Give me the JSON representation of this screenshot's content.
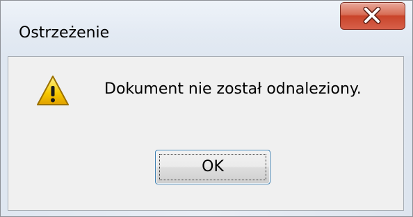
{
  "dialog": {
    "title": "Ostrzeżenie",
    "message": "Dokument nie został odnaleziony.",
    "ok_label": "OK",
    "icon": "warning-icon",
    "close_icon": "close-icon"
  },
  "colors": {
    "close_button": "#c9442a",
    "client_background": "#f0f0f0",
    "warning_yellow": "#f7c800"
  }
}
